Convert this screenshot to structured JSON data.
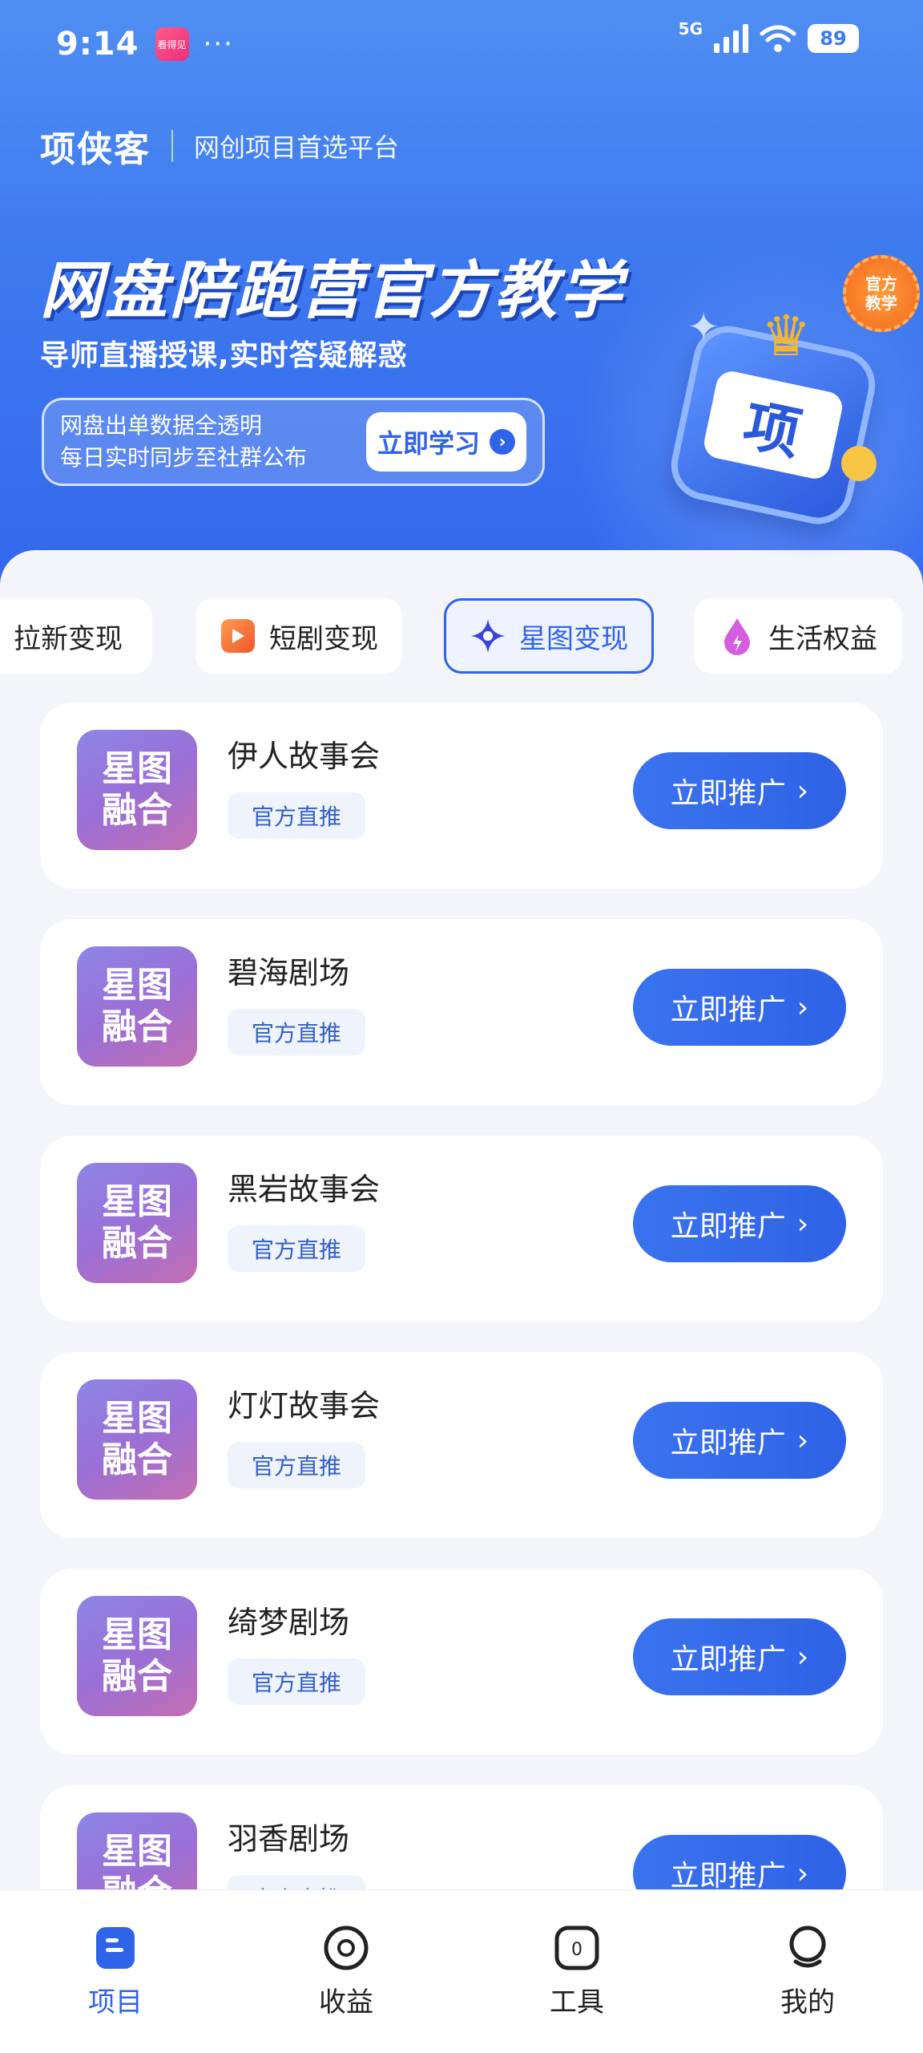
{
  "status_bar": {
    "time": "9:14",
    "app_icon_text": "看得见",
    "dots": "···",
    "network": "5G",
    "battery": "89"
  },
  "header": {
    "brand": "项侠客",
    "slogan": "网创项目首选平台"
  },
  "banner": {
    "title": "网盘陪跑营官方教学",
    "subtitle": "导师直播授课,实时答疑解惑",
    "line1": "网盘出单数据全透明",
    "line2": "每日实时同步至社群公布",
    "cta": "立即学习",
    "badge_line1": "官方",
    "badge_line2": "教学",
    "mascot_text": "项"
  },
  "tabs": [
    {
      "label": "拉新变现",
      "icon": "none"
    },
    {
      "label": "短剧变现",
      "icon": "play-icon"
    },
    {
      "label": "星图变现",
      "icon": "star-icon",
      "active": true
    },
    {
      "label": "生活权益",
      "icon": "drop-icon"
    }
  ],
  "thumb": {
    "line1": "星图",
    "line2": "融合"
  },
  "items": [
    {
      "title": "伊人故事会",
      "tag": "官方直推",
      "button": "立即推广"
    },
    {
      "title": "碧海剧场",
      "tag": "官方直推",
      "button": "立即推广"
    },
    {
      "title": "黑岩故事会",
      "tag": "官方直推",
      "button": "立即推广"
    },
    {
      "title": "灯灯故事会",
      "tag": "官方直推",
      "button": "立即推广"
    },
    {
      "title": "绮梦剧场",
      "tag": "官方直推",
      "button": "立即推广"
    },
    {
      "title": "羽香剧场",
      "tag": "官方直推",
      "button": "立即推广"
    }
  ],
  "nav": [
    {
      "label": "项目",
      "icon": "project-icon",
      "active": true
    },
    {
      "label": "收益",
      "icon": "earnings-icon"
    },
    {
      "label": "工具",
      "icon": "tools-icon",
      "badge": "0"
    },
    {
      "label": "我的",
      "icon": "profile-icon"
    }
  ],
  "colors": {
    "primary": "#2f63e8",
    "hero_top": "#4f8ff3",
    "hero_bottom": "#3367ec",
    "badge": "#f46b1c"
  }
}
